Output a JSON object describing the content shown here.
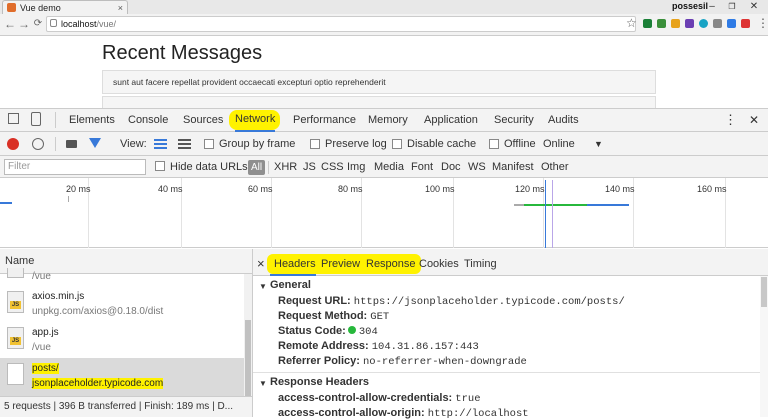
{
  "browser": {
    "tab_title": "Vue demo",
    "tab_close": "×",
    "profile": "possesil",
    "window_controls": [
      "–",
      "❐",
      "✕"
    ],
    "nav": {
      "back": "←",
      "forward": "→",
      "reload": "C"
    },
    "url_host": "localhost",
    "url_path": "/vue/",
    "star": "☆",
    "menu": "⋮"
  },
  "page": {
    "title": "Recent Messages",
    "messages": [
      "sunt aut facere repellat provident occaecati excepturi optio reprehenderit"
    ]
  },
  "devtools": {
    "tabs": [
      "Elements",
      "Console",
      "Sources",
      "Network",
      "Performance",
      "Memory",
      "Application",
      "Security",
      "Audits"
    ],
    "active_tab": "Network",
    "toolbar": {
      "view_label": "View:",
      "group_by_frame": "Group by frame",
      "preserve_log": "Preserve log",
      "disable_cache": "Disable cache",
      "offline": "Offline",
      "throttle": "Online"
    },
    "filter": {
      "placeholder": "Filter",
      "hide_data_urls": "Hide data URLs",
      "types": [
        "All",
        "XHR",
        "JS",
        "CSS",
        "Img",
        "Media",
        "Font",
        "Doc",
        "WS",
        "Manifest",
        "Other"
      ]
    },
    "timeline_ticks": [
      "20 ms",
      "40 ms",
      "60 ms",
      "80 ms",
      "100 ms",
      "120 ms",
      "140 ms",
      "160 ms"
    ],
    "requests": {
      "header": "Name",
      "rows": [
        {
          "name": "",
          "path": "/vue"
        },
        {
          "name": "axios.min.js",
          "path": "unpkg.com/axios@0.18.0/dist"
        },
        {
          "name": "app.js",
          "path": "/vue"
        },
        {
          "name": "posts/",
          "path": "jsonplaceholder.typicode.com"
        }
      ]
    },
    "status": "5 requests  |  396 B transferred  |  Finish: 189 ms  |  D...",
    "details": {
      "close": "×",
      "tabs": [
        "Headers",
        "Preview",
        "Response",
        "Cookies",
        "Timing"
      ],
      "general_title": "General",
      "general": [
        {
          "key": "Request URL:",
          "value": "https://jsonplaceholder.typicode.com/posts/"
        },
        {
          "key": "Request Method:",
          "value": "GET"
        },
        {
          "key": "Status Code:",
          "value": "304"
        },
        {
          "key": "Remote Address:",
          "value": "104.31.86.157:443"
        },
        {
          "key": "Referrer Policy:",
          "value": "no-referrer-when-downgrade"
        }
      ],
      "response_title": "Response Headers",
      "response": [
        {
          "key": "access-control-allow-credentials:",
          "value": "true"
        },
        {
          "key": "access-control-allow-origin:",
          "value": "http://localhost"
        }
      ]
    }
  },
  "colors": {
    "highlight": "#fff200",
    "accent": "#3879d9",
    "status_ok": "#27b83c",
    "record": "#d93025"
  }
}
